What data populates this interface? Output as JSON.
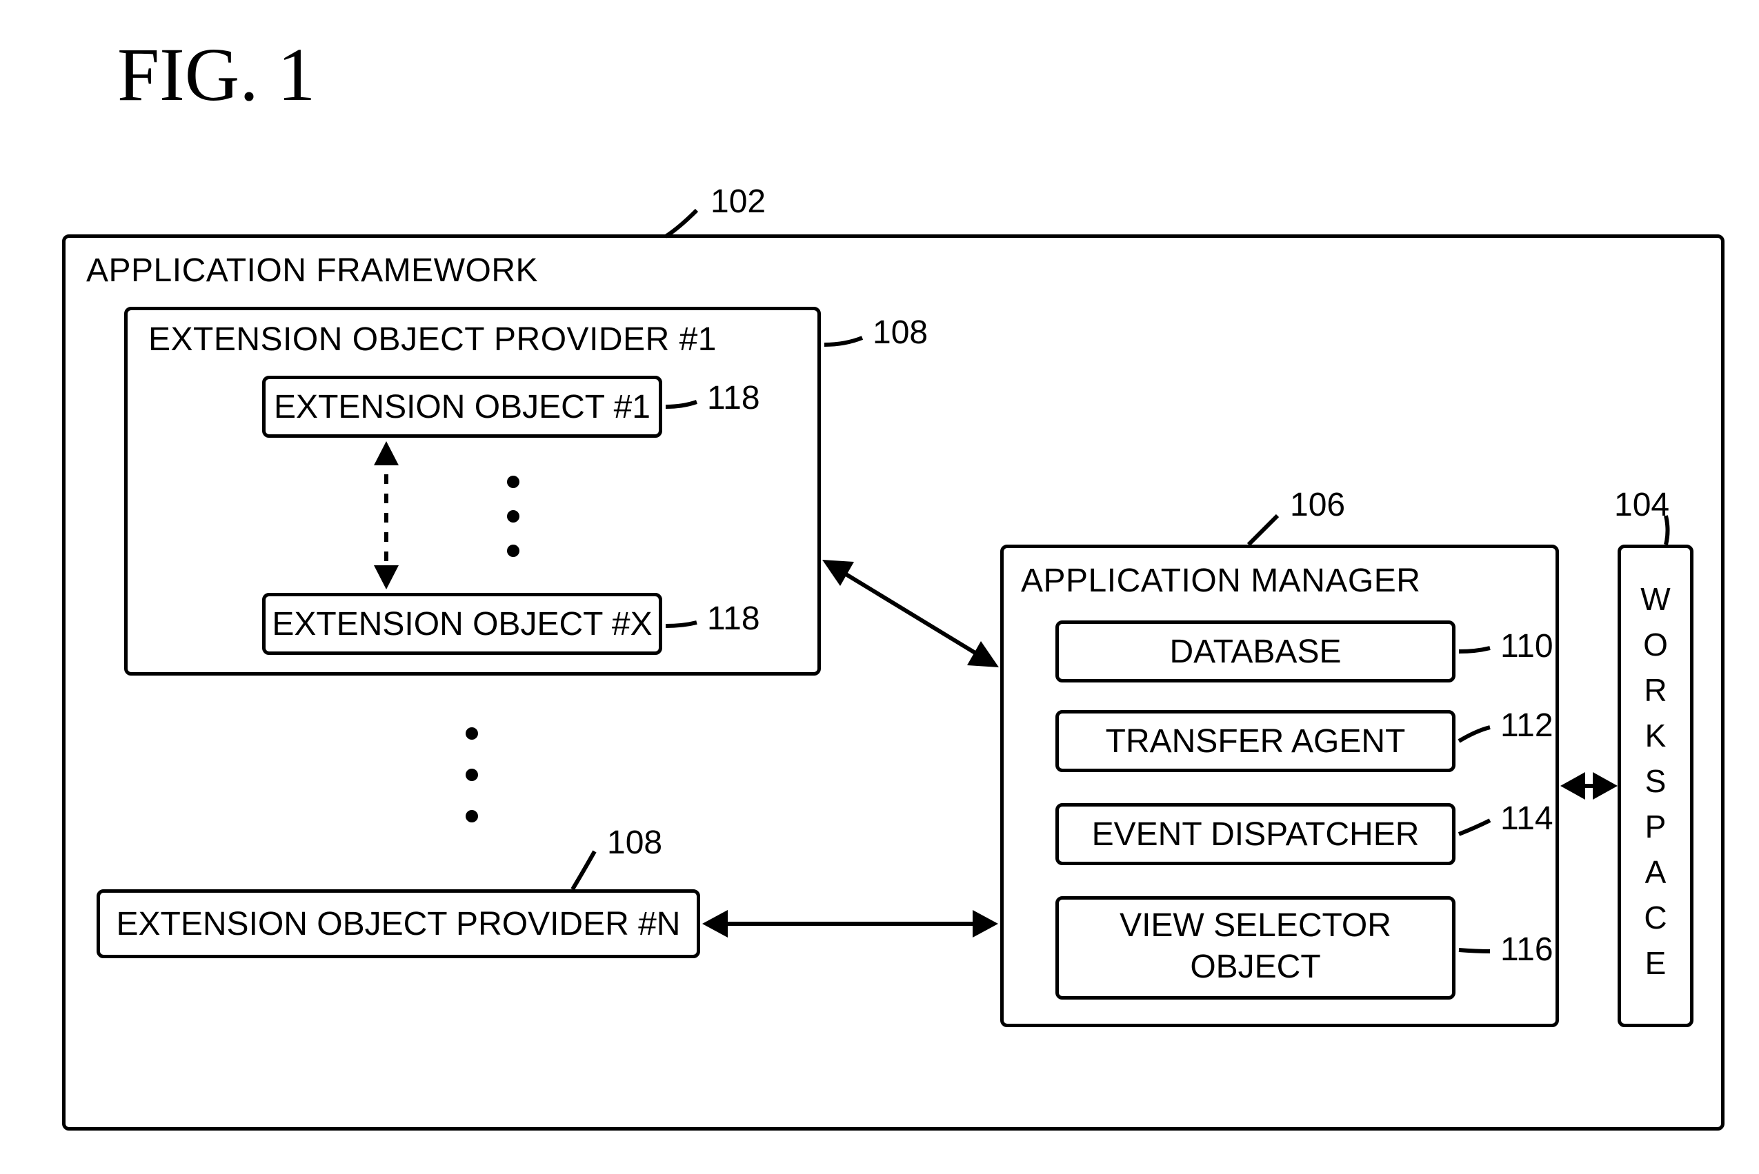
{
  "figure_label": "FIG. 1",
  "framework": {
    "title": "APPLICATION FRAMEWORK",
    "ref": "102"
  },
  "provider1": {
    "title": "EXTENSION OBJECT PROVIDER #1",
    "ref": "108",
    "ext_obj_1": "EXTENSION OBJECT #1",
    "ext_obj_1_ref": "118",
    "ext_obj_x": "EXTENSION OBJECT #X",
    "ext_obj_x_ref": "118"
  },
  "providerN": {
    "title": "EXTENSION OBJECT PROVIDER #N",
    "ref": "108"
  },
  "manager": {
    "title": "APPLICATION MANAGER",
    "ref": "106",
    "database": "DATABASE",
    "database_ref": "110",
    "transfer": "TRANSFER AGENT",
    "transfer_ref": "112",
    "dispatcher": "EVENT DISPATCHER",
    "dispatcher_ref": "114",
    "view_selector_l1": "VIEW SELECTOR",
    "view_selector_l2": "OBJECT",
    "view_selector_ref": "116"
  },
  "workspace": {
    "title": "WORKSPACE",
    "ref": "104"
  }
}
